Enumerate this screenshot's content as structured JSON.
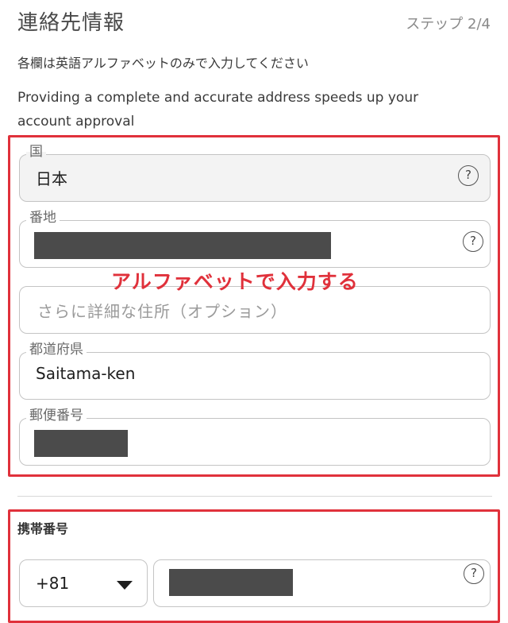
{
  "header": {
    "title": "連絡先情報",
    "step": "ステップ 2/4"
  },
  "note": "各欄は英語アルファベットのみで入力してください",
  "description": "Providing a complete and accurate address speeds up your account approval",
  "address": {
    "country": {
      "label": "国",
      "value": "日本"
    },
    "street": {
      "label": "番地",
      "value": ""
    },
    "address_extra": {
      "placeholder": "さらに詳細な住所（オプション）"
    },
    "prefecture": {
      "label": "都道府県",
      "value": "Saitama-ken"
    },
    "postal_code": {
      "label": "郵便番号",
      "value": ""
    }
  },
  "annotation": "アルファベットで入力する",
  "phone": {
    "label": "携帯番号",
    "country_code": "+81",
    "number": ""
  },
  "icons": {
    "help": "?"
  },
  "colors": {
    "annotation_red": "#e0313b"
  }
}
